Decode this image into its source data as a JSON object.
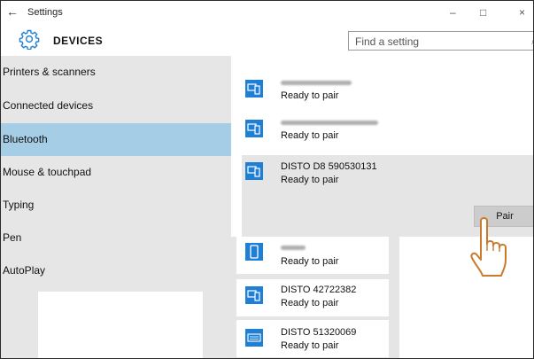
{
  "window": {
    "title": "Settings",
    "back_glyph": "←",
    "minimize_glyph": "–",
    "maximize_glyph": "□",
    "close_glyph": "×"
  },
  "header": {
    "icon": "gear-icon",
    "title": "DEVICES",
    "search_placeholder": "Find a setting",
    "search_icon_glyph": "⌕"
  },
  "sidebar": {
    "items": [
      {
        "label": "Printers & scanners",
        "active": false
      },
      {
        "label": "Connected devices",
        "active": false
      },
      {
        "label": "Bluetooth",
        "active": true
      },
      {
        "label": "Mouse & touchpad",
        "active": false
      },
      {
        "label": "Typing",
        "active": false
      },
      {
        "label": "Pen",
        "active": false
      },
      {
        "label": "AutoPlay",
        "active": false
      }
    ]
  },
  "devices": [
    {
      "name": "",
      "status": "Ready to pair",
      "icon": "phone-pc-icon"
    },
    {
      "name": "",
      "status": "Ready to pair",
      "icon": "phone-pc-icon"
    },
    {
      "name": "DISTO D8 590530131",
      "status": "Ready to pair",
      "icon": "phone-pc-icon"
    },
    {
      "name": "",
      "status": "Ready to pair",
      "icon": "phone-icon"
    },
    {
      "name": "DISTO 42722382",
      "status": "Ready to pair",
      "icon": "phone-pc-icon"
    },
    {
      "name": "DISTO 51320069",
      "status": "Ready to pair",
      "icon": "keyboard-icon"
    }
  ],
  "actions": {
    "pair_label": "Pair"
  },
  "colors": {
    "accent": "#1f7fd4",
    "sidebar_active": "#a6cde6",
    "sidebar_bg": "#e6e6e6",
    "selected_bg": "#e5e5e5"
  }
}
